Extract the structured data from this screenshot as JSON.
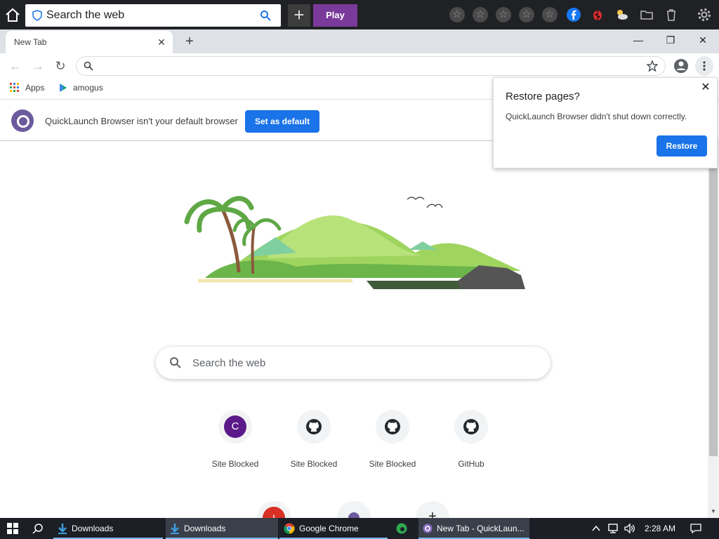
{
  "toolbar": {
    "search_placeholder": "Search the web",
    "play_label": "Play",
    "plus_label": "+",
    "star_glyph": "☆",
    "icons": [
      "home-icon",
      "shield-icon",
      "search-icon",
      "star-icon",
      "facebook-icon",
      "ladybug-icon",
      "weather-icon",
      "folder-icon",
      "trash-icon",
      "settings-icon"
    ]
  },
  "tab": {
    "title": "New Tab",
    "close": "✕",
    "new_tab": "+"
  },
  "window": {
    "minimize": "—",
    "restore": "❐",
    "close": "✕"
  },
  "nav": {
    "back": "←",
    "forward": "→",
    "reload": "↻"
  },
  "bookmarks": [
    {
      "label": "Apps"
    },
    {
      "label": "amogus"
    }
  ],
  "infobar": {
    "message": "QuickLaunch Browser isn't your default browser",
    "button": "Set as default"
  },
  "restore_popup": {
    "title": "Restore pages?",
    "body": "QuickLaunch Browser didn't shut down correctly.",
    "button": "Restore",
    "close": "✕"
  },
  "ntp": {
    "search_placeholder": "Search the web",
    "tiles": [
      {
        "label": "Site Blocked",
        "letter": "C",
        "color": "#5b1a8a"
      },
      {
        "label": "Site Blocked",
        "letter": "",
        "color": ""
      },
      {
        "label": "Site Blocked",
        "letter": "",
        "color": ""
      },
      {
        "label": "GitHub",
        "letter": "",
        "color": ""
      }
    ],
    "partial_tile_letter": "I"
  },
  "taskbar": {
    "items": [
      {
        "label": "Downloads"
      },
      {
        "label": "Downloads"
      },
      {
        "label": "Google Chrome"
      },
      {
        "label": "New Tab - QuickLaun..."
      }
    ],
    "clock": "2:28 AM"
  },
  "colors": {
    "accent": "#1a73e8",
    "play": "#7a3a9a",
    "brand": "#6b5a9d"
  }
}
